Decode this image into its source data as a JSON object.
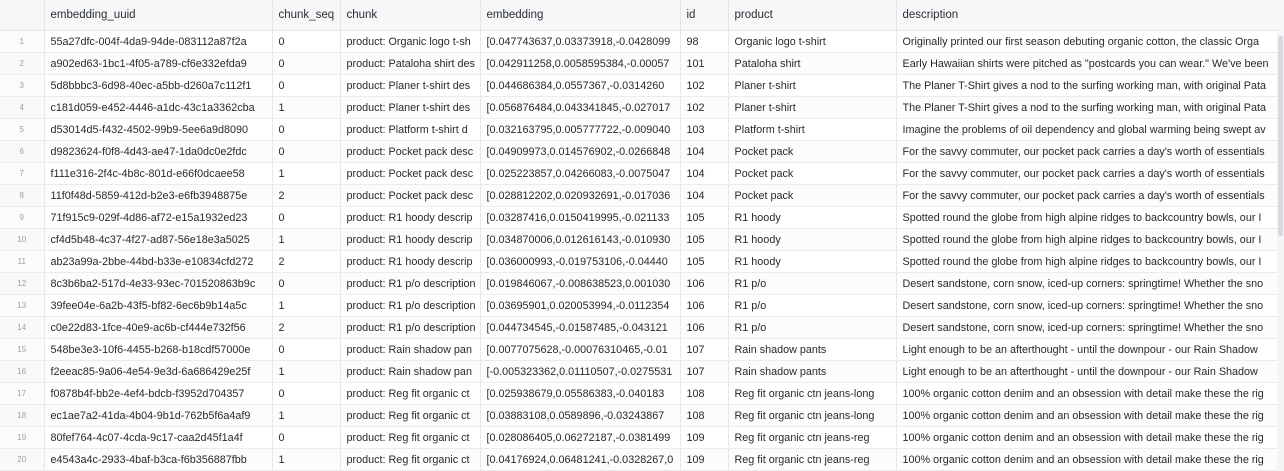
{
  "columns": [
    "",
    "embedding_uuid",
    "chunk_seq",
    "chunk",
    "embedding",
    "id",
    "product",
    "description"
  ],
  "rows": [
    [
      "1",
      "55a27dfc-004f-4da9-94de-083112a87f2a",
      "0",
      "product: Organic logo t-sh",
      "[0.047743637,0.03373918,-0.0428099",
      "98",
      "Organic logo t-shirt",
      "Originally printed our first season debuting organic cotton, the classic Orga"
    ],
    [
      "2",
      "a902ed63-1bc1-4f05-a789-cf6e332efda9",
      "0",
      "product: Pataloha shirt des",
      "[0.042911258,0.0058595384,-0.00057",
      "101",
      "Pataloha shirt",
      "Early Hawaiian shirts were pitched as \"postcards you can wear.\" We've been"
    ],
    [
      "3",
      "5d8bbbc3-6d98-40ec-a5bb-d260a7c112f1",
      "0",
      "product: Planer t-shirt des",
      "[0.044686384,0.0557367,-0.0314260",
      "102",
      "Planer t-shirt",
      "The Planer T-Shirt gives a nod to the surfing working man, with original Pata"
    ],
    [
      "4",
      "c181d059-e452-4446-a1dc-43c1a3362cba",
      "1",
      "product: Planer t-shirt des",
      "[0.056876484,0.043341845,-0.027017",
      "102",
      "Planer t-shirt",
      "The Planer T-Shirt gives a nod to the surfing working man, with original Pata"
    ],
    [
      "5",
      "d53014d5-f432-4502-99b9-5ee6a9d8090",
      "0",
      "product: Platform t-shirt d",
      "[0.032163795,0.005777722,-0.009040",
      "103",
      "Platform t-shirt",
      "Imagine the problems of oil dependency and global warming being swept av"
    ],
    [
      "6",
      "d9823624-f0f8-4d43-ae47-1da0dc0e2fdc",
      "0",
      "product: Pocket pack desc",
      "[0.04909973,0.014576902,-0.0266848",
      "104",
      "Pocket pack",
      "For the savvy commuter, our pocket pack carries a day's worth of essentials"
    ],
    [
      "7",
      "f111e316-2f4c-4b8c-801d-e66f0dcaee58",
      "1",
      "product: Pocket pack desc",
      "[0.025223857,0.04266083,-0.0075047",
      "104",
      "Pocket pack",
      "For the savvy commuter, our pocket pack carries a day's worth of essentials"
    ],
    [
      "8",
      "11f0f48d-5859-412d-b2e3-e6fb3948875e",
      "2",
      "product: Pocket pack desc",
      "[0.028812202,0.020932691,-0.017036",
      "104",
      "Pocket pack",
      "For the savvy commuter, our pocket pack carries a day's worth of essentials"
    ],
    [
      "9",
      "71f915c9-029f-4d86-af72-e15a1932ed23",
      "0",
      "product: R1 hoody descrip",
      "[0.03287416,0.0150419995,-0.021133",
      "105",
      "R1 hoody",
      "Spotted round the globe from high alpine ridges to backcountry bowls, our I"
    ],
    [
      "10",
      "cf4d5b48-4c37-4f27-ad87-56e18e3a5025",
      "1",
      "product: R1 hoody descrip",
      "[0.034870006,0.012616143,-0.010930",
      "105",
      "R1 hoody",
      "Spotted round the globe from high alpine ridges to backcountry bowls, our I"
    ],
    [
      "11",
      "ab23a99a-2bbe-44bd-b33e-e10834cfd272",
      "2",
      "product: R1 hoody descrip",
      "[0.036000993,-0.019753106,-0.04440",
      "105",
      "R1 hoody",
      "Spotted round the globe from high alpine ridges to backcountry bowls, our I"
    ],
    [
      "12",
      "8c3b6ba2-517d-4e33-93ec-701520863b9c",
      "0",
      "product: R1 p/o description",
      "[0.019846067,-0.008638523,0.001030",
      "106",
      "R1 p/o",
      "Desert sandstone, corn snow, iced-up corners: springtime! Whether the sno"
    ],
    [
      "13",
      "39fee04e-6a2b-43f5-bf82-6ec6b9b14a5c",
      "1",
      "product: R1 p/o description",
      "[0.03695901,0.020053994,-0.0112354",
      "106",
      "R1 p/o",
      "Desert sandstone, corn snow, iced-up corners: springtime! Whether the sno"
    ],
    [
      "14",
      "c0e22d83-1fce-40e9-ac6b-cf444e732f56",
      "2",
      "product: R1 p/o description",
      "[0.044734545,-0.01587485,-0.043121",
      "106",
      "R1 p/o",
      "Desert sandstone, corn snow, iced-up corners: springtime! Whether the sno"
    ],
    [
      "15",
      "548be3e3-10f6-4455-b268-b18cdf57000e",
      "0",
      "product: Rain shadow pan",
      "[0.0077075628,-0.00076310465,-0.01",
      "107",
      "Rain shadow pants",
      "Light enough to be an afterthought - until the downpour - our Rain Shadow"
    ],
    [
      "16",
      "f2eeac85-9a06-4e54-9e3d-6a686429e25f",
      "1",
      "product: Rain shadow pan",
      "[-0.005323362,0.01110507,-0.0275531",
      "107",
      "Rain shadow pants",
      "Light enough to be an afterthought - until the downpour - our Rain Shadow"
    ],
    [
      "17",
      "f0878b4f-bb2e-4ef4-bdcb-f3952d704357",
      "0",
      "product: Reg fit organic ct",
      "[0.025938679,0.05586383,-0.040183",
      "108",
      "Reg fit organic ctn jeans-long",
      "100% organic cotton denim and an obsession with detail make these the rig"
    ],
    [
      "18",
      "ec1ae7a2-41da-4b04-9b1d-762b5f6a4af9",
      "1",
      "product: Reg fit organic ct",
      "[0.03883108,0.0589896,-0.03243867",
      "108",
      "Reg fit organic ctn jeans-long",
      "100% organic cotton denim and an obsession with detail make these the rig"
    ],
    [
      "19",
      "80fef764-4c07-4cda-9c17-caa2d45f1a4f",
      "0",
      "product: Reg fit organic ct",
      "[0.028086405,0.06272187,-0.0381499",
      "109",
      "Reg fit organic ctn jeans-reg",
      "100% organic cotton denim and an obsession with detail make these the rig"
    ],
    [
      "20",
      "e4543a4c-2933-4baf-b3ca-f6b356887fbb",
      "1",
      "product: Reg fit organic ct",
      "[0.04176924,0.06481241,-0.0328267,0",
      "109",
      "Reg fit organic ctn jeans-reg",
      "100% organic cotton denim and an obsession with detail make these the rig"
    ]
  ]
}
